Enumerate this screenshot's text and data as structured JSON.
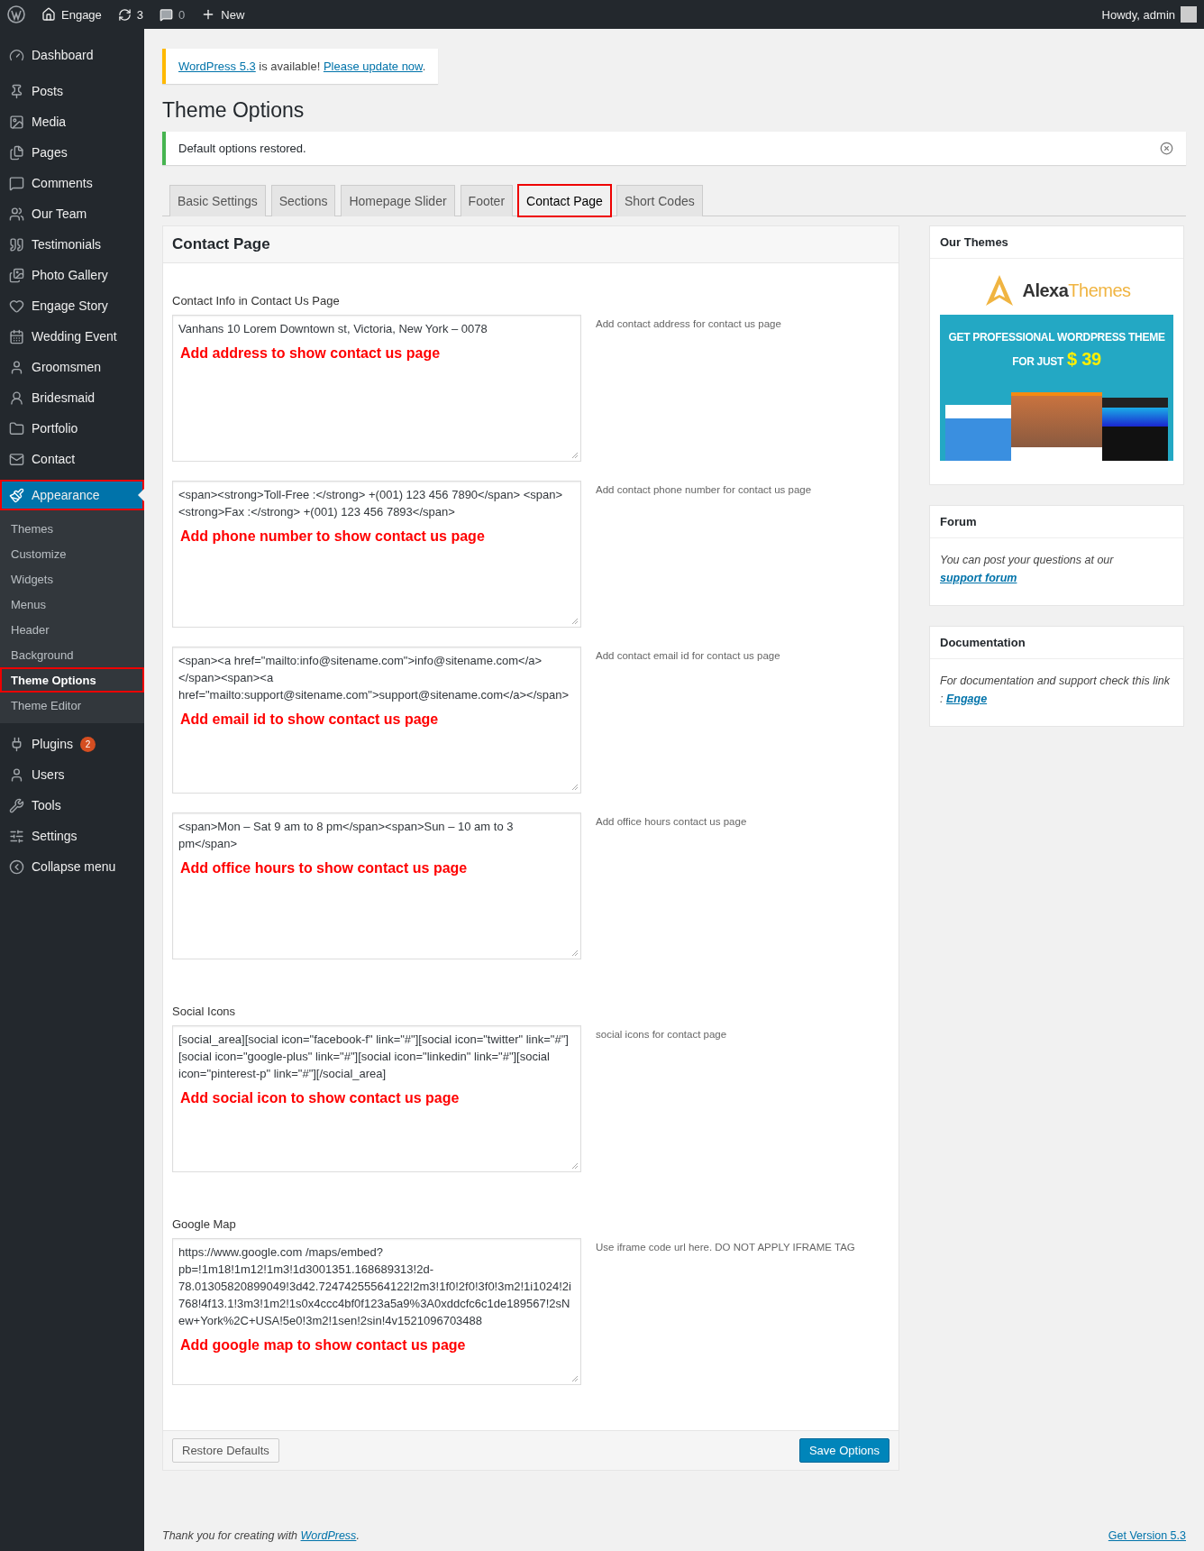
{
  "admin_bar": {
    "site_name": "Engage",
    "updates_count": "3",
    "comments_count": "0",
    "new_label": "New",
    "greeting": "Howdy, admin"
  },
  "sidebar": {
    "items": [
      {
        "label": "Dashboard",
        "selected": false,
        "highlighted": false
      },
      {
        "label": "Posts",
        "selected": false,
        "highlighted": false
      },
      {
        "label": "Media",
        "selected": false,
        "highlighted": false
      },
      {
        "label": "Pages",
        "selected": false,
        "highlighted": false
      },
      {
        "label": "Comments",
        "selected": false,
        "highlighted": false
      },
      {
        "label": "Our Team",
        "selected": false,
        "highlighted": false
      },
      {
        "label": "Testimonials",
        "selected": false,
        "highlighted": false
      },
      {
        "label": "Photo Gallery",
        "selected": false,
        "highlighted": false
      },
      {
        "label": "Engage Story",
        "selected": false,
        "highlighted": false
      },
      {
        "label": "Wedding Event",
        "selected": false,
        "highlighted": false
      },
      {
        "label": "Groomsmen",
        "selected": false,
        "highlighted": false
      },
      {
        "label": "Bridesmaid",
        "selected": false,
        "highlighted": false
      },
      {
        "label": "Portfolio",
        "selected": false,
        "highlighted": false
      },
      {
        "label": "Contact",
        "selected": false,
        "highlighted": false
      },
      {
        "label": "Appearance",
        "selected": true,
        "highlighted": true,
        "children": [
          {
            "label": "Themes",
            "selected": false,
            "highlighted": false
          },
          {
            "label": "Customize",
            "selected": false,
            "highlighted": false
          },
          {
            "label": "Widgets",
            "selected": false,
            "highlighted": false
          },
          {
            "label": "Menus",
            "selected": false,
            "highlighted": false
          },
          {
            "label": "Header",
            "selected": false,
            "highlighted": false
          },
          {
            "label": "Background",
            "selected": false,
            "highlighted": false
          },
          {
            "label": "Theme Options",
            "selected": true,
            "highlighted": true
          },
          {
            "label": "Theme Editor",
            "selected": false,
            "highlighted": false
          }
        ]
      },
      {
        "label": "Plugins",
        "selected": false,
        "highlighted": false,
        "badge": "2"
      },
      {
        "label": "Users",
        "selected": false,
        "highlighted": false
      },
      {
        "label": "Tools",
        "selected": false,
        "highlighted": false
      },
      {
        "label": "Settings",
        "selected": false,
        "highlighted": false
      },
      {
        "label": "Collapse menu",
        "selected": false,
        "highlighted": false
      }
    ]
  },
  "update_notice": {
    "parts": [
      {
        "kind": "link",
        "text": "WordPress 5.3"
      },
      {
        "kind": "text",
        "text": " is available! "
      },
      {
        "kind": "link",
        "text": "Please update now"
      },
      {
        "kind": "text",
        "text": "."
      }
    ]
  },
  "page_title": "Theme Options",
  "success_notice": {
    "message": "Default options restored."
  },
  "tabs": [
    {
      "label": "Basic Settings",
      "selected": false,
      "highlighted": false
    },
    {
      "label": "Sections",
      "selected": false,
      "highlighted": false
    },
    {
      "label": "Homepage Slider",
      "selected": false,
      "highlighted": false
    },
    {
      "label": "Footer",
      "selected": false,
      "highlighted": false
    },
    {
      "label": "Contact Page",
      "selected": true,
      "highlighted": true
    },
    {
      "label": "Short Codes",
      "selected": false,
      "highlighted": false
    }
  ],
  "panel": {
    "title": "Contact Page",
    "fields": [
      {
        "label": "Contact Info in Contact Us Page",
        "value": "Vanhans 10 Lorem Downtown st, Victoria, New York – 0078",
        "annotation": "Add address to show contact us page",
        "description": "Add contact address for contact us page"
      },
      {
        "value": "<span><strong>Toll-Free :</strong>  +(001) 123 456 7890</span> <span><strong>Fax :</strong>  +(001) 123 456 7893</span>",
        "annotation": "Add phone number to show contact us page",
        "description": "Add contact phone number for contact us page"
      },
      {
        "value": "<span><a href=\"mailto:info@sitename.com\">info@sitename.com</a></span><span><a href=\"mailto:support@sitename.com\">support@sitename.com</a></span>",
        "annotation": "Add email id to show contact us page",
        "description": "Add contact email id for contact us page"
      },
      {
        "value": "<span>Mon – Sat 9 am to 8 pm</span><span>Sun – 10 am to 3 pm</span>",
        "annotation": "Add office hours to show contact us page",
        "description": "Add office hours contact us page"
      },
      {
        "label": "Social Icons",
        "value": "[social_area][social icon=\"facebook-f\" link=\"#\"][social icon=\"twitter\" link=\"#\"][social icon=\"google-plus\" link=\"#\"][social icon=\"linkedin\" link=\"#\"][social icon=\"pinterest-p\" link=\"#\"][/social_area]",
        "annotation": "Add social icon to show contact us page",
        "description": "social icons for contact page"
      },
      {
        "label": "Google Map",
        "value": "https://www.google.com /maps/embed?pb=!1m18!1m12!1m3!1d3001351.168689313!2d-78.01305820899049!3d42.72474255564122!2m3!1f0!2f0!3f0!3m2!1i1024!2i768!4f13.1!3m3!1m2!1s0x4ccc4bf0f123a5a9%3A0xddcfc6c1de189567!2sNew+York%2C+USA!5e0!3m2!1sen!2sin!4v1521096703488",
        "annotation": "Add google map to show contact us page",
        "description": "Use iframe code url here. DO NOT APPLY IFRAME TAG"
      }
    ],
    "restore_button": "Restore Defaults",
    "save_button": "Save Options"
  },
  "widgets": {
    "our_themes": {
      "title": "Our Themes",
      "logo_first": "Alexa",
      "logo_second": "Themes",
      "banner_headline": "GET PROFESSIONAL WORDPRESS THEME",
      "banner_prefix": "FOR JUST",
      "banner_price": "$ 39"
    },
    "forum": {
      "title": "Forum",
      "parts": [
        {
          "kind": "text",
          "text": "You can post your questions at our "
        },
        {
          "kind": "link",
          "text": "support forum"
        }
      ]
    },
    "documentation": {
      "title": "Documentation",
      "parts": [
        {
          "kind": "text",
          "text": "For documentation and support check this link : "
        },
        {
          "kind": "link",
          "text": "Engage"
        }
      ]
    }
  },
  "footer": {
    "parts": [
      {
        "kind": "text",
        "text": "Thank you for creating with "
      },
      {
        "kind": "link",
        "text": "WordPress"
      },
      {
        "kind": "text",
        "text": "."
      }
    ],
    "version_link": "Get Version 5.3"
  }
}
